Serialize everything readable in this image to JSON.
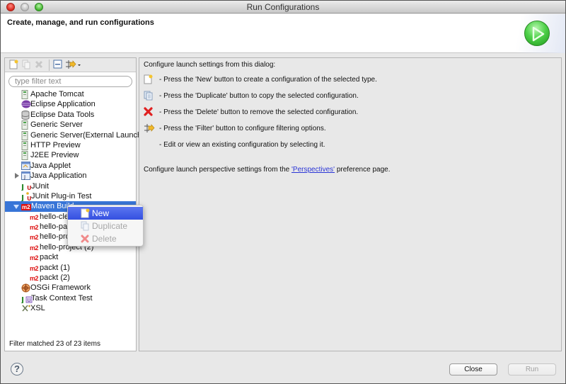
{
  "window": {
    "title": "Run Configurations"
  },
  "banner": {
    "title": "Create, manage, and run configurations",
    "icon": "run-icon"
  },
  "toolbar": {
    "buttons": [
      {
        "name": "new-launch-config-button",
        "icon": "new-config-icon",
        "enabled": true
      },
      {
        "name": "duplicate-button",
        "icon": "duplicate-icon",
        "enabled": false
      },
      {
        "name": "delete-button",
        "icon": "delete-icon",
        "enabled": false
      },
      {
        "name": "collapse-all-button",
        "icon": "collapse-all-icon",
        "enabled": true
      },
      {
        "name": "filter-button",
        "icon": "filter-icon",
        "enabled": true
      }
    ]
  },
  "filter": {
    "placeholder": "type filter text",
    "value": ""
  },
  "tree": {
    "items": [
      {
        "label": "Apache Tomcat",
        "icon": "server-icon",
        "level": 0
      },
      {
        "label": "Eclipse Application",
        "icon": "eclipse-icon",
        "level": 0
      },
      {
        "label": "Eclipse Data Tools",
        "icon": "database-icon",
        "level": 0
      },
      {
        "label": "Generic Server",
        "icon": "server-icon",
        "level": 0
      },
      {
        "label": "Generic Server(External Launch)",
        "icon": "server-icon",
        "level": 0
      },
      {
        "label": "HTTP Preview",
        "icon": "server-icon",
        "level": 0
      },
      {
        "label": "J2EE Preview",
        "icon": "server-icon",
        "level": 0
      },
      {
        "label": "Java Applet",
        "icon": "java-applet-icon",
        "level": 0
      },
      {
        "label": "Java Application",
        "icon": "java-application-icon",
        "level": 0,
        "expandable": true,
        "expanded": false
      },
      {
        "label": "JUnit",
        "icon": "junit-icon",
        "level": 0
      },
      {
        "label": "JUnit Plug-in Test",
        "icon": "junit-plugin-icon",
        "level": 0
      },
      {
        "label": "Maven Build",
        "icon": "maven-icon",
        "level": 0,
        "expandable": true,
        "expanded": true,
        "selected": true
      },
      {
        "label": "hello-clean",
        "icon": "maven-icon",
        "level": 1
      },
      {
        "label": "hello-package",
        "icon": "maven-icon",
        "level": 1
      },
      {
        "label": "hello-project",
        "icon": "maven-icon",
        "level": 1
      },
      {
        "label": "hello-project (2)",
        "icon": "maven-icon",
        "level": 1
      },
      {
        "label": "packt",
        "icon": "maven-icon",
        "level": 1
      },
      {
        "label": "packt (1)",
        "icon": "maven-icon",
        "level": 1
      },
      {
        "label": "packt (2)",
        "icon": "maven-icon",
        "level": 1
      },
      {
        "label": "OSGi Framework",
        "icon": "osgi-icon",
        "level": 0
      },
      {
        "label": "Task Context Test",
        "icon": "task-context-icon",
        "level": 0
      },
      {
        "label": "XSL",
        "icon": "xsl-icon",
        "level": 0
      }
    ]
  },
  "status": {
    "text": "Filter matched 23 of 23 items"
  },
  "context_menu": {
    "items": [
      {
        "label": "New",
        "icon": "new-config-icon",
        "active": true,
        "enabled": true
      },
      {
        "label": "Duplicate",
        "icon": "duplicate-icon",
        "active": false,
        "enabled": false
      },
      {
        "label": "Delete",
        "icon": "delete-icon",
        "active": false,
        "enabled": false
      }
    ]
  },
  "help": {
    "intro": "Configure launch settings from this dialog:",
    "lines": [
      {
        "icon": "new-config-icon",
        "text": "- Press the 'New' button to create a configuration of the selected type."
      },
      {
        "icon": "duplicate-icon",
        "text": "- Press the 'Duplicate' button to copy the selected configuration."
      },
      {
        "icon": "delete-icon",
        "text": "- Press the 'Delete' button to remove the selected configuration."
      },
      {
        "icon": "filter-icon",
        "text": "- Press the 'Filter' button to configure filtering options."
      },
      {
        "icon": "",
        "text": "- Edit or view an existing configuration by selecting it."
      }
    ],
    "perspective_prefix": "Configure launch perspective settings from the ",
    "perspective_link": "'Perspectives'",
    "perspective_suffix": " preference page."
  },
  "footer": {
    "help_label": "?",
    "close_label": "Close",
    "run_label": "Run",
    "run_enabled": false
  },
  "colors": {
    "selection": "#3875d7",
    "menu_active": "#3d58e6",
    "link": "#2a35d6",
    "maven_red": "#dd1111",
    "run_green": "#3cc23a"
  }
}
